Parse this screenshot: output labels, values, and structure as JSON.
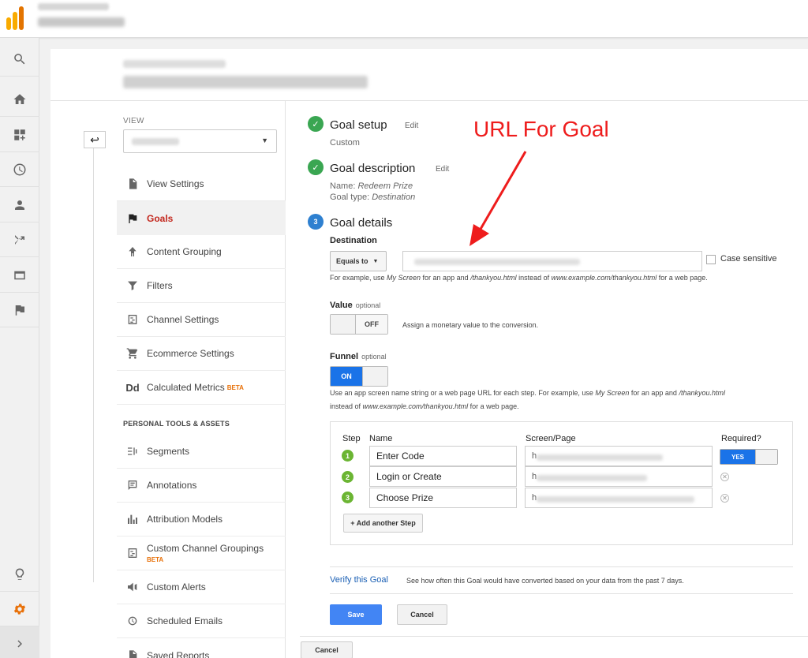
{
  "annotation": "URL For Goal",
  "nav": {
    "view_label": "VIEW",
    "items": [
      {
        "label": "View Settings",
        "icon": "document-icon"
      },
      {
        "label": "Goals",
        "icon": "flag-icon"
      },
      {
        "label": "Content Grouping",
        "icon": "person-walk-icon"
      },
      {
        "label": "Filters",
        "icon": "filter-icon"
      },
      {
        "label": "Channel Settings",
        "icon": "channel-icon"
      },
      {
        "label": "Ecommerce Settings",
        "icon": "cart-icon"
      },
      {
        "label": "Calculated Metrics",
        "icon": "dd-icon",
        "badge": "BETA"
      }
    ],
    "personal_header": "PERSONAL TOOLS & ASSETS",
    "personal_items": [
      {
        "label": "Segments",
        "icon": "segments-icon"
      },
      {
        "label": "Annotations",
        "icon": "comment-icon"
      },
      {
        "label": "Attribution Models",
        "icon": "bar-chart-icon"
      },
      {
        "label": "Custom Channel Groupings",
        "icon": "channel-icon",
        "badge": "BETA"
      },
      {
        "label": "Custom Alerts",
        "icon": "megaphone-icon"
      },
      {
        "label": "Scheduled Emails",
        "icon": "clock-icon"
      },
      {
        "label": "Saved Reports",
        "icon": "document-icon"
      }
    ]
  },
  "goal": {
    "setup": {
      "title": "Goal setup",
      "edit": "Edit",
      "value": "Custom"
    },
    "description": {
      "title": "Goal description",
      "edit": "Edit",
      "name_label": "Name: ",
      "name_value": "Redeem Prize",
      "type_label": "Goal type: ",
      "type_value": "Destination"
    },
    "details": {
      "num": "3",
      "title": "Goal details"
    },
    "destination": {
      "label": "Destination",
      "match_type": "Equals to",
      "case_sensitive_label": "Case sensitive",
      "help_a": "For example, use ",
      "help_b": "My Screen",
      "help_c": " for an app and ",
      "help_d": "/thankyou.html",
      "help_e": " instead of ",
      "help_f": "www.example.com/thankyou.html",
      "help_g": " for a web page."
    },
    "value": {
      "label": "Value",
      "optional": "optional",
      "toggle": "OFF",
      "help": "Assign a monetary value to the conversion."
    },
    "funnel": {
      "label": "Funnel",
      "optional": "optional",
      "toggle": "ON",
      "help_a": "Use an app screen name string or a web page URL for each step. For example, use ",
      "help_b": "My Screen",
      "help_c": " for an app and ",
      "help_d": "/thankyou.html",
      "help_e": "instead of ",
      "help_f": "www.example.com/thankyou.html",
      "help_g": " for a web page.",
      "headers": {
        "step": "Step",
        "name": "Name",
        "screen": "Screen/Page",
        "required": "Required?"
      },
      "steps": [
        {
          "num": "1",
          "name": "Enter Code",
          "screen_prefix": "h"
        },
        {
          "num": "2",
          "name": "Login or Create",
          "screen_prefix": "h"
        },
        {
          "num": "3",
          "name": "Choose Prize",
          "screen_prefix": "h"
        }
      ],
      "required_toggle": "YES",
      "add_step": "+ Add another Step"
    },
    "verify": {
      "link": "Verify this Goal",
      "text": "See how often this Goal would have converted based on your data from the past 7 days."
    },
    "save": "Save",
    "cancel": "Cancel",
    "cancel_outer": "Cancel"
  },
  "colors": {
    "accent": "#1a73e8",
    "active_nav": "#c3271d",
    "done": "#3aa652",
    "annotation": "#ee1c1c"
  }
}
